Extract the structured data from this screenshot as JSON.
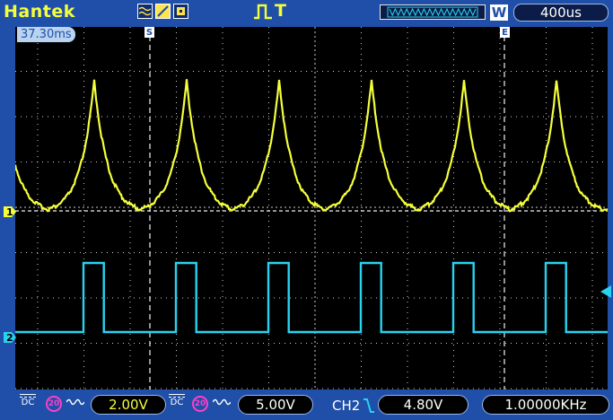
{
  "header": {
    "brand": "Hantek",
    "run_state_icon": "pulse-run-icon",
    "trigger_glyph": "T",
    "memory_badge": "W",
    "timebase": "400us"
  },
  "screen": {
    "cursor_time": "37.30ms",
    "marker_start": "S",
    "marker_end": "E",
    "ch1_marker": "1",
    "ch2_marker": "2"
  },
  "footer": {
    "ch1": {
      "coupling": "DC",
      "bw_limit": "20",
      "scale": "2.00V"
    },
    "ch2": {
      "coupling": "DC",
      "bw_limit": "20",
      "scale": "5.00V"
    },
    "trigger": {
      "source": "CH2",
      "edge": "falling-edge-icon",
      "level": "4.80V"
    },
    "frequency": "1.00000KHz"
  },
  "colors": {
    "ch1": "#f4ff3a",
    "ch2": "#29d3f0",
    "frame": "#1f4fa8",
    "grid": "#ffffff"
  },
  "waveforms": {
    "timebase_per_div": "400us",
    "ch1": {
      "shape": "exponential-spike",
      "period_divisions": 2.5
    },
    "ch2": {
      "shape": "square-pulse",
      "period_divisions": 2.5,
      "duty": 0.22
    }
  }
}
